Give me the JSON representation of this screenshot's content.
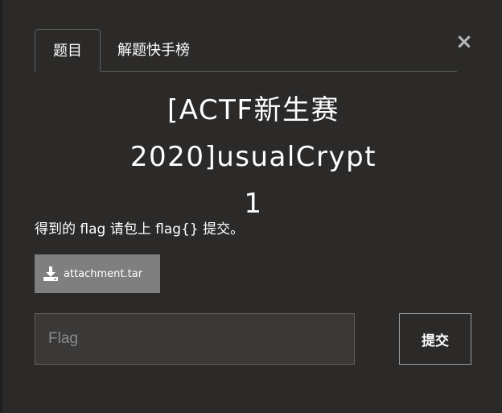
{
  "tabs": [
    {
      "label": "题目",
      "active": true
    },
    {
      "label": "解题快手榜",
      "active": false
    }
  ],
  "close": {
    "label": "×"
  },
  "challenge": {
    "title_line1": "[ACTF新生赛",
    "title_line2": "2020]usualCrypt",
    "title_line3": "1",
    "description": "得到的 flag 请包上 flag{} 提交。"
  },
  "attachment": {
    "icon": "download-icon",
    "filename": "attachment.tar"
  },
  "flag_form": {
    "placeholder": "Flag",
    "value": "",
    "submit_label": "提交"
  },
  "colors": {
    "background": "#2b2a29",
    "attachment_button": "#7f7f7f",
    "input_background": "#3a3938"
  }
}
